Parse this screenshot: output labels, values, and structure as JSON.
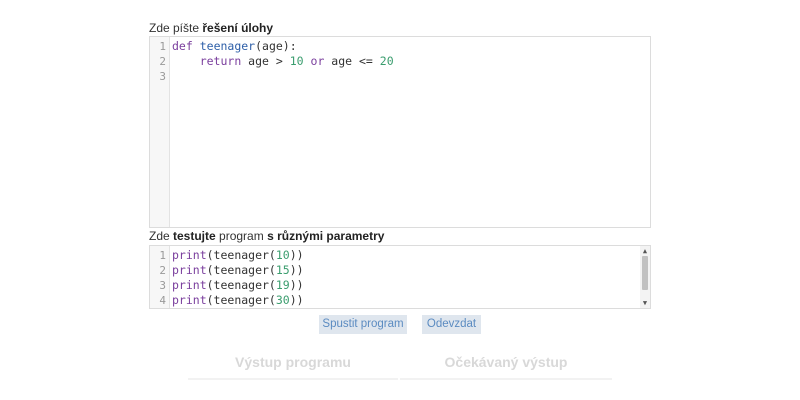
{
  "editor": {
    "label_prefix": "Zde píšte ",
    "label_bold": "řešení úlohy",
    "lines": [
      {
        "n": "1",
        "tokens": [
          {
            "t": "def",
            "c": "kw"
          },
          {
            "t": " ",
            "c": ""
          },
          {
            "t": "teenager",
            "c": "fn"
          },
          {
            "t": "(age):",
            "c": ""
          }
        ]
      },
      {
        "n": "2",
        "tokens": [
          {
            "t": "    ",
            "c": ""
          },
          {
            "t": "return",
            "c": "kw"
          },
          {
            "t": " age > ",
            "c": ""
          },
          {
            "t": "10",
            "c": "num"
          },
          {
            "t": " ",
            "c": ""
          },
          {
            "t": "or",
            "c": "kw"
          },
          {
            "t": " age <= ",
            "c": ""
          },
          {
            "t": "20",
            "c": "num"
          }
        ]
      },
      {
        "n": "3",
        "tokens": []
      }
    ]
  },
  "tester": {
    "label_prefix": "Zde ",
    "label_bold1": "testujte",
    "label_mid": " program ",
    "label_bold2": "s různými parametry",
    "lines": [
      {
        "n": "1",
        "tokens": [
          {
            "t": "print",
            "c": "pb"
          },
          {
            "t": "(teenager(",
            "c": ""
          },
          {
            "t": "10",
            "c": "num"
          },
          {
            "t": "))",
            "c": ""
          }
        ]
      },
      {
        "n": "2",
        "tokens": [
          {
            "t": "print",
            "c": "pb"
          },
          {
            "t": "(teenager(",
            "c": ""
          },
          {
            "t": "15",
            "c": "num"
          },
          {
            "t": "))",
            "c": ""
          }
        ]
      },
      {
        "n": "3",
        "tokens": [
          {
            "t": "print",
            "c": "pb"
          },
          {
            "t": "(teenager(",
            "c": ""
          },
          {
            "t": "19",
            "c": "num"
          },
          {
            "t": "))",
            "c": ""
          }
        ]
      },
      {
        "n": "4",
        "tokens": [
          {
            "t": "print",
            "c": "pb"
          },
          {
            "t": "(teenager(",
            "c": ""
          },
          {
            "t": "30",
            "c": "num"
          },
          {
            "t": "))",
            "c": ""
          }
        ]
      }
    ],
    "scroll_up_glyph": "▲",
    "scroll_down_glyph": "▼"
  },
  "buttons": {
    "run": "Spustit program",
    "submit": "Odevzdat"
  },
  "output": {
    "program_output": "Výstup programu",
    "expected_output": "Očekávaný výstup"
  },
  "colors": {
    "button_bg": "#dfe6ee",
    "button_text": "#5b8bc1",
    "keyword": "#7a3e9d",
    "function": "#2e5fa8",
    "number": "#3a9d6e"
  }
}
